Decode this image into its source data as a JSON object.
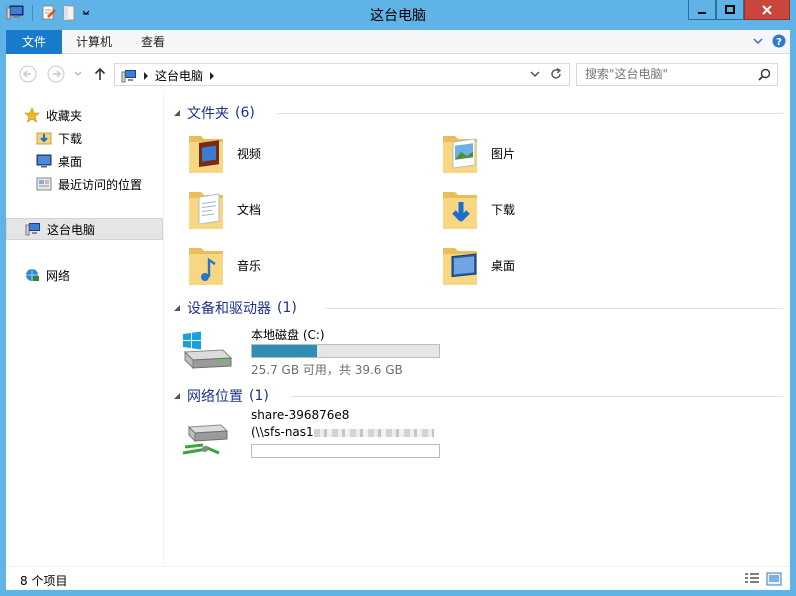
{
  "window": {
    "title": "这台电脑"
  },
  "ribbon": {
    "tabs": [
      "文件",
      "计算机",
      "查看"
    ]
  },
  "address": {
    "crumb": "这台电脑"
  },
  "search": {
    "placeholder": "搜索\"这台电脑\""
  },
  "nav": {
    "favorites_label": "收藏夹",
    "favorites": [
      "下载",
      "桌面",
      "最近访问的位置"
    ],
    "this_pc": "这台电脑",
    "network": "网络"
  },
  "groups": {
    "folders": {
      "title": "文件夹",
      "count": "(6)"
    },
    "devices": {
      "title": "设备和驱动器",
      "count": "(1)"
    },
    "netloc": {
      "title": "网络位置",
      "count": "(1)"
    }
  },
  "folders": [
    "视频",
    "图片",
    "文档",
    "下载",
    "音乐",
    "桌面"
  ],
  "drive": {
    "name": "本地磁盘 (C:)",
    "usage": "25.7 GB 可用，共 39.6 GB",
    "used_fraction": 0.35
  },
  "network_share": {
    "name": "share-396876e8",
    "path": "(\\\\sfs-nas1"
  },
  "status": {
    "count": "8 个项目"
  },
  "colors": {
    "accent": "#1979ca",
    "frame": "#5fb3e6",
    "group_heading": "#1e3287",
    "bar_fill": "#2f8eb3"
  }
}
